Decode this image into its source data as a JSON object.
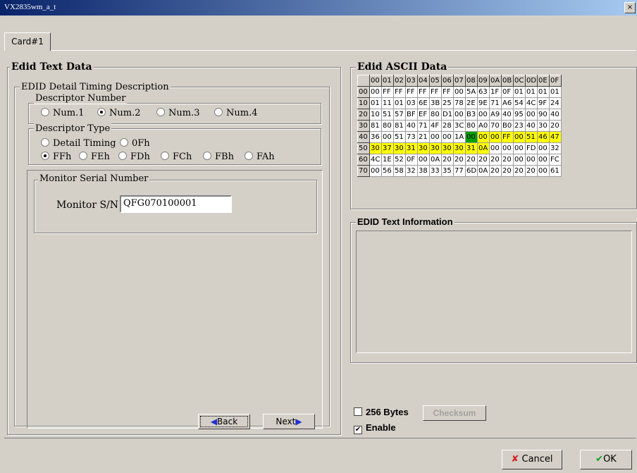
{
  "window": {
    "title": "VX2835wm_a_t",
    "close_glyph": "×"
  },
  "tab": {
    "label": "Card#1"
  },
  "left": {
    "title": "Edid Text Data",
    "timing_group": "EDID Detail Timing Description",
    "descriptor_number": {
      "label": "Descriptor Number",
      "options": [
        "Num.1",
        "Num.2",
        "Num.3",
        "Num.4"
      ],
      "selected": "Num.2"
    },
    "descriptor_type": {
      "label": "Descriptor Type",
      "row1": [
        "Detail Timing",
        "0Fh"
      ],
      "row2": [
        "FFh",
        "FEh",
        "FDh",
        "FCh",
        "FBh",
        "FAh"
      ],
      "selected": "FFh"
    },
    "serial": {
      "group_label": "Monitor Serial Number",
      "field_label": "Monitor S/N",
      "value": "QFG070100001"
    },
    "back_label": "Back",
    "next_label": "Next"
  },
  "right": {
    "title": "Edid ASCII Data",
    "columns": [
      "00",
      "01",
      "02",
      "03",
      "04",
      "05",
      "06",
      "07",
      "08",
      "09",
      "0A",
      "0B",
      "0C",
      "0D",
      "0E",
      "0F"
    ],
    "rows": [
      {
        "addr": "00",
        "cells": [
          "00",
          "FF",
          "FF",
          "FF",
          "FF",
          "FF",
          "FF",
          "00",
          "5A",
          "63",
          "1F",
          "0F",
          "01",
          "01",
          "01",
          "01"
        ]
      },
      {
        "addr": "10",
        "cells": [
          "01",
          "11",
          "01",
          "03",
          "6E",
          "3B",
          "25",
          "78",
          "2E",
          "9E",
          "71",
          "A6",
          "54",
          "4C",
          "9F",
          "24"
        ]
      },
      {
        "addr": "20",
        "cells": [
          "10",
          "51",
          "57",
          "BF",
          "EF",
          "80",
          "D1",
          "00",
          "B3",
          "00",
          "A9",
          "40",
          "95",
          "00",
          "90",
          "40"
        ]
      },
      {
        "addr": "30",
        "cells": [
          "81",
          "80",
          "81",
          "40",
          "71",
          "4F",
          "28",
          "3C",
          "80",
          "A0",
          "70",
          "B0",
          "23",
          "40",
          "30",
          "20"
        ]
      },
      {
        "addr": "40",
        "cells": [
          "36",
          "00",
          "51",
          "73",
          "21",
          "00",
          "00",
          "1A",
          "00",
          "00",
          "00",
          "FF",
          "00",
          "51",
          "46",
          "47"
        ]
      },
      {
        "addr": "50",
        "cells": [
          "30",
          "37",
          "30",
          "31",
          "30",
          "30",
          "30",
          "30",
          "31",
          "0A",
          "00",
          "00",
          "00",
          "FD",
          "00",
          "32"
        ]
      },
      {
        "addr": "60",
        "cells": [
          "4C",
          "1E",
          "52",
          "0F",
          "00",
          "0A",
          "20",
          "20",
          "20",
          "20",
          "20",
          "20",
          "00",
          "00",
          "00",
          "FC"
        ]
      },
      {
        "addr": "70",
        "cells": [
          "00",
          "56",
          "58",
          "32",
          "38",
          "33",
          "35",
          "77",
          "6D",
          "0A",
          "20",
          "20",
          "20",
          "20",
          "00",
          "61"
        ]
      }
    ],
    "highlight": {
      "green": "#00a000",
      "yellow": "#ffff00"
    },
    "text_info_title": "EDID Text Information",
    "text_info_value": "",
    "bytes256_label": "256 Bytes",
    "checksum_label": "Checksum",
    "enable_label": "Enable",
    "enable_checked": "✔"
  },
  "footer": {
    "cancel_label": "Cancel",
    "ok_label": "OK"
  }
}
